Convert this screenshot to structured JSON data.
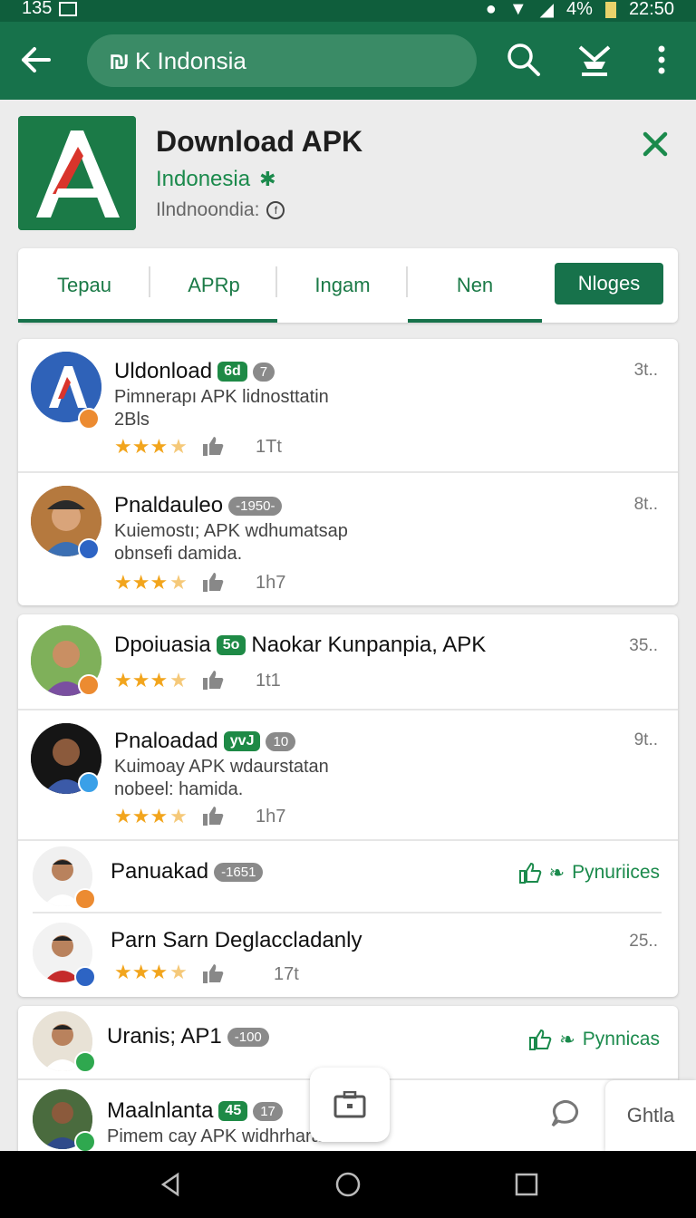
{
  "status_bar": {
    "left_text": "135",
    "battery": "4%",
    "time": "22:50"
  },
  "app_bar": {
    "search_text": "K Indonsia"
  },
  "header": {
    "title": "Download APK",
    "subtitle": "Indonesia",
    "region": "Ilndnoondia:"
  },
  "tabs": [
    {
      "label": "Tepau"
    },
    {
      "label": "APRp"
    },
    {
      "label": "Ingam"
    },
    {
      "label": "Nen"
    },
    {
      "label": "Nloges"
    }
  ],
  "items": [
    {
      "name": "Uldonload",
      "chip1": "6d",
      "chip2": "7",
      "desc1": "Pimnerapı APK lidnosttatin",
      "desc2": "2Bls",
      "count": "1Tt",
      "size": "3t.."
    },
    {
      "name": "Pnaldauleo",
      "chip2": "-1950-",
      "desc1": "Kuiemostı; APK wdhumatsap",
      "desc2": "obnsefi damida.",
      "count": "1h7",
      "size": "8t.."
    },
    {
      "name": "Dpoiuasia",
      "chip1": "5o",
      "name2": "Naokar Kunpanpia, APK",
      "count": "1t1",
      "size": "35.."
    },
    {
      "name": "Pnaloadad",
      "chip1": "yvJ",
      "chip2": "10",
      "desc1": "Kuimoay APK wdaurstatan",
      "desc2": "nobeel: hamida.",
      "count": "1h7",
      "size": "9t.."
    },
    {
      "name": "Panuakad",
      "chip2": "-1651",
      "follow": "Pynuriices"
    },
    {
      "name": "Parn Sarn Deglaccladanly",
      "count": "17t",
      "size": "25.."
    },
    {
      "name": "Uranis; AP1",
      "chip2": "-100",
      "follow": "Pynnicas"
    },
    {
      "name": "Maalnlanta",
      "chip1": "45",
      "chip2": "17",
      "desc1": "Pimem cay APK widhrharadı."
    }
  ],
  "floating": {
    "side_button": "Ghtla"
  },
  "colors": {
    "primary": "#17724b",
    "accent": "#1b8a4c",
    "star": "#f2a51d"
  }
}
